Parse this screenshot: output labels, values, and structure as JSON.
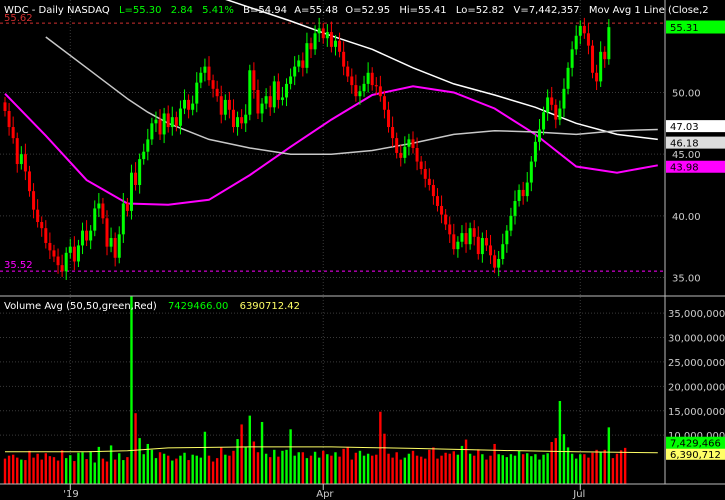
{
  "header": {
    "symbol": "WDC - Daily  NASDAQ",
    "last": "L=55.30",
    "change": "2.84",
    "change_pct": "5.41%",
    "bid": "B=54.94",
    "ask": "A=55.48",
    "open": "O=52.95",
    "high": "Hi=55.41",
    "low": "Lo=52.82",
    "volume": "V=7,442,357",
    "study": "Mov Avg 1 Line (Close,2"
  },
  "volume_header": {
    "label": "Volume Avg (50,50,green,Red)",
    "value_1": "7429466.00",
    "value_2": "6390712.42"
  },
  "colors": {
    "background": "#000000",
    "up": "#00ff00",
    "down": "#ff0000",
    "ma_magenta": "#ff00ff",
    "ma_white": "#ffffff",
    "ma_gray": "#c8c8c8",
    "vol_avg": "#ffff66",
    "level_line": "#d03030",
    "text": "#ffffff",
    "axis": "#cccccc"
  },
  "price_axis": {
    "labels": [
      "50.00",
      "45.00",
      "40.00",
      "35.00"
    ],
    "values": [
      50,
      45,
      40,
      35
    ]
  },
  "price_tags": {
    "last": "55.31",
    "ma_white": "47.03",
    "ma_gray": "46.18",
    "ma_magenta": "43.98"
  },
  "price_levels": {
    "high_label": "55.62",
    "low_label": "35.52"
  },
  "volume_axis": {
    "labels": [
      "35,000,000",
      "30,000,000",
      "25,000,000",
      "20,000,000",
      "15,000,000",
      "10,000,000"
    ],
    "values": [
      35000000,
      30000000,
      25000000,
      20000000,
      15000000,
      10000000
    ]
  },
  "volume_tags": {
    "last": "7,429,466",
    "avg": "6,390,712"
  },
  "x_axis": {
    "labels": [
      "'19",
      "Apr",
      "Jul"
    ]
  },
  "chart_data": {
    "type": "candlestick",
    "ylim": [
      33.5,
      57.5
    ],
    "volume_ylim": [
      0,
      38500000
    ],
    "x_labels": [
      {
        "label": "'19",
        "index": 16
      },
      {
        "label": "Apr",
        "index": 78
      },
      {
        "label": "Jul",
        "index": 141
      }
    ],
    "closes": [
      48.5,
      47.2,
      46.3,
      44.2,
      45.0,
      43.6,
      42.0,
      40.5,
      39.5,
      39.0,
      37.8,
      37.2,
      36.7,
      36.0,
      35.5,
      37.0,
      37.5,
      36.3,
      37.6,
      38.8,
      38.0,
      38.8,
      40.6,
      41.0,
      39.8,
      37.5,
      38.2,
      36.6,
      38.5,
      41.0,
      40.4,
      43.5,
      42.5,
      44.6,
      45.2,
      46.2,
      47.5,
      47.8,
      46.6,
      48.3,
      47.2,
      48.0,
      47.3,
      48.7,
      49.4,
      48.6,
      49.1,
      50.8,
      51.6,
      52.1,
      51.0,
      50.3,
      49.7,
      48.2,
      49.4,
      48.6,
      47.2,
      48.0,
      47.5,
      48.2,
      51.8,
      50.2,
      48.3,
      49.1,
      49.7,
      48.8,
      50.9,
      49.4,
      49.6,
      50.7,
      51.3,
      52.1,
      52.6,
      52.0,
      54.0,
      53.5,
      54.8,
      55.2,
      54.4,
      54.9,
      53.7,
      54.2,
      53.3,
      52.1,
      51.3,
      50.6,
      49.7,
      50.1,
      50.7,
      51.6,
      50.6,
      50.5,
      49.7,
      48.6,
      47.2,
      46.3,
      45.1,
      44.7,
      45.6,
      46.2,
      45.5,
      44.4,
      43.8,
      43.0,
      42.5,
      41.6,
      40.8,
      40.1,
      39.3,
      38.5,
      37.3,
      37.9,
      38.6,
      37.7,
      39.0,
      38.3,
      36.9,
      38.2,
      37.6,
      36.8,
      35.8,
      36.5,
      37.7,
      38.8,
      40.0,
      41.2,
      42.1,
      41.6,
      42.7,
      44.4,
      46.0,
      47.0,
      48.4,
      49.6,
      49.0,
      47.8,
      48.7,
      50.3,
      52.0,
      53.5,
      54.6,
      55.4,
      54.8,
      53.8,
      51.6,
      50.9,
      53.3,
      52.7,
      55.3
    ],
    "volumes": [
      5.2,
      5.8,
      6.0,
      5.4,
      5.0,
      4.9,
      6.8,
      5.4,
      6.2,
      5.0,
      6.3,
      5.7,
      5.5,
      4.8,
      6.9,
      5.3,
      5.9,
      4.7,
      6.4,
      6.5,
      5.1,
      6.7,
      4.4,
      7.6,
      5.2,
      4.6,
      7.9,
      5.0,
      6.3,
      4.9,
      5.5,
      38.5,
      14.5,
      9.4,
      6.1,
      8.2,
      7.0,
      5.3,
      6.5,
      6.2,
      5.8,
      4.8,
      5.2,
      5.8,
      6.4,
      4.9,
      6.0,
      5.8,
      5.4,
      10.7,
      5.8,
      4.6,
      5.3,
      7.5,
      6.0,
      5.8,
      6.8,
      9.2,
      12.2,
      7.5,
      14.0,
      8.7,
      6.5,
      12.7,
      6.2,
      5.5,
      7.0,
      5.6,
      6.8,
      7.0,
      11.2,
      5.8,
      6.5,
      6.5,
      5.3,
      5.8,
      6.6,
      5.4,
      6.8,
      6.1,
      5.8,
      6.5,
      5.6,
      7.2,
      7.6,
      5.0,
      6.4,
      6.8,
      5.8,
      6.2,
      5.8,
      6.0,
      14.8,
      10.3,
      6.2,
      5.4,
      6.5,
      5.0,
      5.4,
      6.2,
      6.8,
      5.8,
      5.6,
      5.2,
      7.0,
      7.5,
      5.2,
      5.8,
      6.4,
      6.2,
      6.7,
      6.0,
      7.8,
      9.1,
      6.2,
      5.8,
      7.1,
      6.1,
      5.0,
      5.8,
      8.2,
      6.1,
      5.9,
      5.5,
      6.1,
      5.8,
      6.8,
      6.1,
      6.3,
      5.7,
      6.1,
      5.0,
      6.0,
      6.3,
      8.6,
      9.4,
      17.0,
      10.2,
      7.5,
      6.2,
      5.2,
      6.1,
      6.1,
      5.4,
      6.4,
      7.0,
      6.5,
      7.0,
      11.6,
      5.3,
      6.2,
      6.9,
      7.4
    ],
    "series": [
      {
        "name": "Mov Avg 1 Line (Close,2",
        "kind": "ma_magenta",
        "x": [
          0,
          10,
          20,
          30,
          40,
          50,
          60,
          70,
          80,
          90,
          100,
          110,
          120,
          130,
          140,
          150,
          160
        ],
        "y": [
          49.9,
          46.5,
          42.9,
          41.0,
          40.9,
          41.3,
          43.3,
          45.6,
          47.8,
          49.8,
          50.5,
          50.0,
          48.7,
          46.6,
          44.0,
          43.5,
          44.1
        ]
      },
      {
        "name": "",
        "kind": "ma_white",
        "x": [
          50,
          60,
          70,
          80,
          90,
          100,
          110,
          120,
          130,
          140,
          150,
          160
        ],
        "y": [
          58.0,
          56.9,
          55.8,
          54.6,
          53.5,
          52.0,
          50.7,
          49.8,
          48.8,
          47.5,
          46.6,
          46.2
        ]
      },
      {
        "name": "",
        "kind": "ma_gray",
        "x": [
          10,
          20,
          30,
          35,
          40,
          50,
          60,
          70,
          80,
          90,
          100,
          110,
          120,
          130,
          140,
          150,
          160
        ],
        "y": [
          54.5,
          52.0,
          49.5,
          48.4,
          47.5,
          46.2,
          45.5,
          45.0,
          45.0,
          45.3,
          45.9,
          46.6,
          46.9,
          46.8,
          46.6,
          46.9,
          47.0
        ]
      }
    ],
    "volume_avg": {
      "name": "Volume Avg (50,50,green,Red)",
      "x": [
        0,
        20,
        30,
        40,
        60,
        80,
        100,
        120,
        140,
        150,
        160
      ],
      "y": [
        6.6,
        6.6,
        6.8,
        7.4,
        7.6,
        7.6,
        7.3,
        6.9,
        6.6,
        6.5,
        6.4
      ]
    }
  }
}
